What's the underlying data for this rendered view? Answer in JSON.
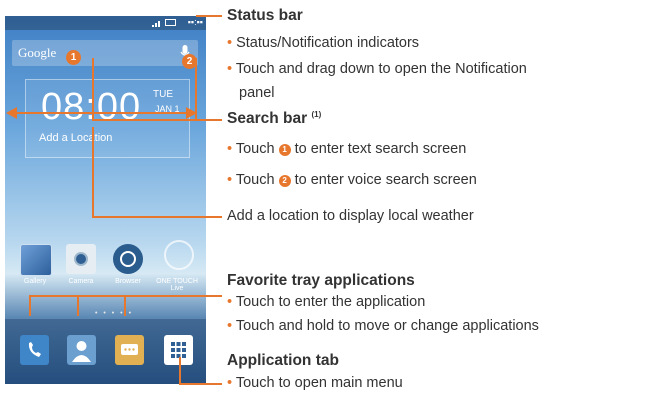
{
  "phone": {
    "search_logo": "Google",
    "marker_1": "1",
    "marker_2": "2",
    "clock_time": "08:00",
    "clock_day": "TUE",
    "clock_date": "JAN 1",
    "add_location": "Add a Location",
    "apps": [
      "Gallery",
      "Camera",
      "Browser",
      "ONE TOUCH Live"
    ],
    "dock_icons": [
      "phone-icon",
      "contacts-icon",
      "messaging-icon",
      "app-grid-icon"
    ],
    "accent_color": "#e8772e"
  },
  "annotations": {
    "status_bar": {
      "heading": "Status bar",
      "bullets": [
        "Status/Notification indicators",
        "Touch and drag down to open the Notification",
        "panel"
      ]
    },
    "search_bar": {
      "heading": "Search bar",
      "footnote": "(1)",
      "bullet_1_pre": "Touch",
      "bullet_1_num": "1",
      "bullet_1_post": "to enter text search screen",
      "bullet_2_pre": "Touch",
      "bullet_2_num": "2",
      "bullet_2_post": "to enter voice search screen"
    },
    "location": {
      "text": "Add a location to display local weather"
    },
    "favorite_tray": {
      "heading": "Favorite tray applications",
      "bullets": [
        "Touch to enter the application",
        "Touch and hold to move or change applications"
      ]
    },
    "app_tab": {
      "heading": "Application tab",
      "bullets": [
        "Touch to open main menu"
      ]
    }
  }
}
